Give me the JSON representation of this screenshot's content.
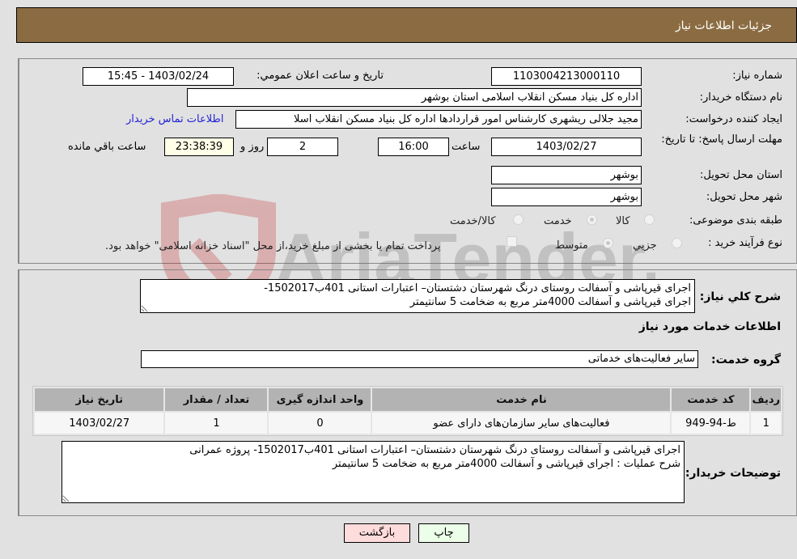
{
  "header": {
    "title": "جزئیات اطلاعات نیاز"
  },
  "form": {
    "need_number": {
      "label": "شماره نیاز:",
      "value": "1103004213000110"
    },
    "announce_datetime": {
      "label": "تاریخ و ساعت اعلان عمومي:",
      "value": "1403/02/24 - 15:45"
    },
    "buyer_org": {
      "label": "نام دستگاه خریدار:",
      "value": "اداره کل بنیاد مسکن انقلاب اسلامی استان بوشهر"
    },
    "requester": {
      "label": "ایجاد کننده درخواست:",
      "value": "مجید جلالی ریشهری کارشناس امور قراردادها اداره کل بنیاد مسکن انقلاب اسلا"
    },
    "buyer_contact_link": "اطلاعات تماس خریدار",
    "deadline": {
      "label": "مهلت ارسال پاسخ: تا تاریخ:",
      "date": "1403/02/27",
      "time_label": "ساعت",
      "time": "16:00",
      "days": "2",
      "days_label": "روز و",
      "remaining": "23:38:39",
      "remaining_label": "ساعت باقي مانده"
    },
    "delivery_province": {
      "label": "استان محل تحویل:",
      "value": "بوشهر"
    },
    "delivery_city": {
      "label": "شهر محل تحویل:",
      "value": "بوشهر"
    },
    "category": {
      "label": "طبقه بندی موضوعی:",
      "options": [
        "کالا",
        "خدمت",
        "کالا/خدمت"
      ],
      "selected": "خدمت"
    },
    "purchase_process": {
      "label": "نوع فرآیند خرید :",
      "options": [
        "جزيي",
        "متوسط"
      ],
      "selected": "متوسط",
      "treasury_note": "پرداخت تمام یا بخشی از مبلغ خرید،از محل \"اسناد خزانه اسلامی\" خواهد بود."
    }
  },
  "description": {
    "label": "شرح كلي نیاز:",
    "value": "اجرای قیرپاشی و آسفالت روستای درنگ شهرستان دشتستان– اعتبارات استانی 401ب1502017-\nاجرای قیرپاشی و آسفالت 4000متر مربع به ضخامت 5 سانتیمتر"
  },
  "services": {
    "section_title": "اطلاعات خدمات مورد نیاز",
    "group_label": "گروه خدمت:",
    "group_value": "سایر فعالیت‌های خدماتی",
    "table": {
      "columns": [
        "ردیف",
        "کد خدمت",
        "نام خدمت",
        "واحد اندازه گیری",
        "تعداد / مقدار",
        "تاریخ نیاز"
      ],
      "rows": [
        [
          "1",
          "ط-94-949",
          "فعالیت‌های سایر سازمان‌های دارای عضو",
          "0",
          "1",
          "1403/02/27"
        ]
      ]
    }
  },
  "buyer_notes": {
    "label": "توضیحات خریدار:",
    "value": "اجرای قیرپاشی و آسفالت روستای درنگ شهرستان دشتستان– اعتبارات استانی 401ب1502017- پروژه عمرانی\nشرح عملیات : اجرای قیرپاشی و آسفالت 4000متر مربع به ضخامت 5 سانتیمتر"
  },
  "buttons": {
    "print": "چاپ",
    "back": "بازگشت"
  },
  "watermark": {
    "text": "AriaTender.neT"
  },
  "colors": {
    "header_bg": "#8b6c42",
    "link": "#2323d6",
    "print_bg": "#ecffe8",
    "back_bg": "#ffdcdc"
  }
}
